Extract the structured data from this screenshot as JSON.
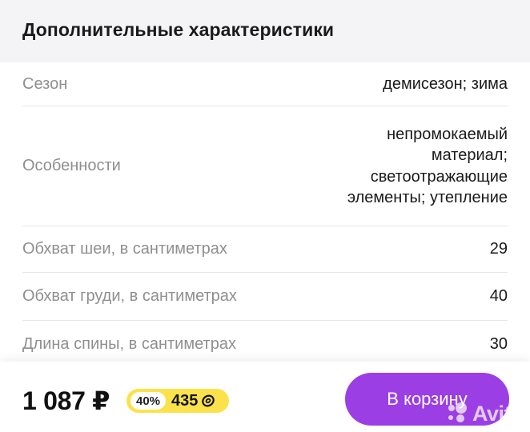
{
  "header": {
    "title": "Дополнительные характеристики"
  },
  "specs": [
    {
      "label": "Сезон",
      "value": "демисезон; зима"
    },
    {
      "label": "Особенности",
      "value": "непромокаемый материал; светоотражающие элементы; утепление"
    },
    {
      "label": "Обхват шеи, в сантиметрах",
      "value": "29"
    },
    {
      "label": "Обхват груди, в сантиметрах",
      "value": "40"
    },
    {
      "label": "Длина спины, в сантиметрах",
      "value": "30"
    }
  ],
  "purchase": {
    "price": "1 087 ₽",
    "bonus_percent": "40%",
    "bonus_amount": "435",
    "bonus_icon": "bonus-coin-icon",
    "cart_label": "В корзину",
    "accent_color": "#9b3fe4",
    "bonus_color": "#fbe24a"
  },
  "watermark": {
    "text": "Avito",
    "icon": "avito-logo-icon"
  }
}
